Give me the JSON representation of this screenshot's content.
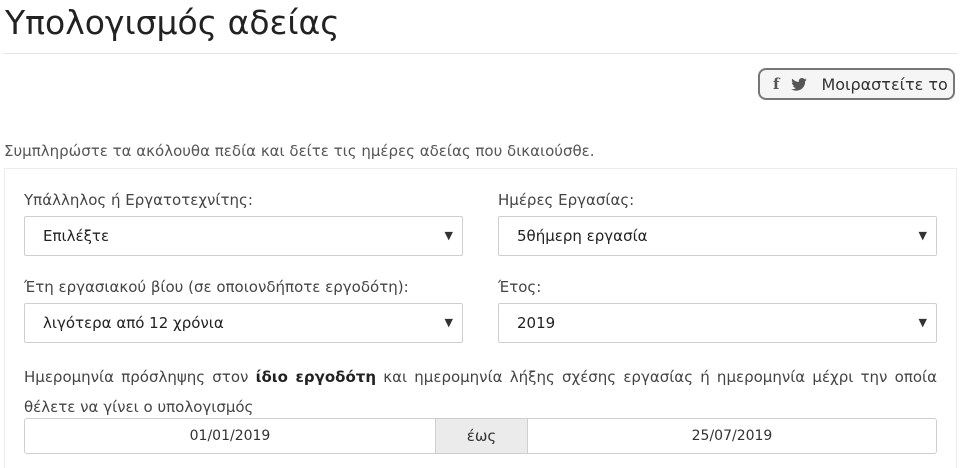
{
  "page": {
    "title": "Υπολογισμός αδείας",
    "share": {
      "facebook_icon": "facebook-icon",
      "twitter_icon": "twitter-icon",
      "label": "Μοιραστείτε το"
    },
    "intro": "Συμπληρώστε τα ακόλουθα πεδία και δείτε τις ημέρες αδείας που δικαιούσθε."
  },
  "form": {
    "employee_type": {
      "label": "Υπάλληλος ή Εργατοτεχνίτης:",
      "value": "Επιλέξτε"
    },
    "work_days": {
      "label": "Ημέρες Εργασίας:",
      "value": "5θήμερη εργασία"
    },
    "years": {
      "label": "Έτη εργασιακού βίου (σε οποιονδήποτε εργοδότη):",
      "value": "λιγότερα από 12 χρόνια"
    },
    "year": {
      "label": "Έτος:",
      "value": "2019"
    },
    "dates_text_before": "Ημερομηνία πρόσληψης στον ",
    "dates_text_bold": "ίδιο εργοδότη",
    "dates_text_after": " και ημερομηνία λήξης σχέσης εργασίας ή ημερομηνία μέχρι την οποία θέλετε να γίνει ο υπολογισμός",
    "date_from": "01/01/2019",
    "date_sep": "έως",
    "date_to": "25/07/2019"
  }
}
